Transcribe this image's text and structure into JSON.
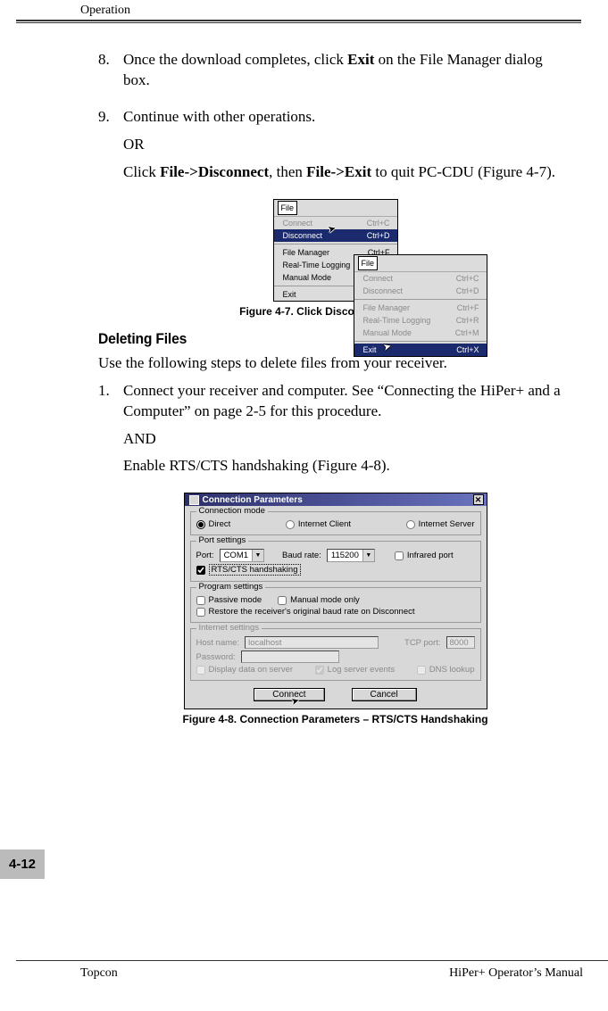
{
  "header": {
    "running_head": "Operation"
  },
  "body": {
    "step8_num": "8.",
    "step8_text_a": "Once the download completes, click ",
    "step8_bold": "Exit",
    "step8_text_b": " on the File Manager dialog box.",
    "step9_num": "9.",
    "step9_text": "Continue with other operations.",
    "or": "OR",
    "step9b_a": "Click ",
    "step9b_bold1": "File->Disconnect",
    "step9b_mid": ", then ",
    "step9b_bold2": "File->Exit",
    "step9b_end": " to quit PC-CDU (Figure 4-7).",
    "fig47_cap": "Figure 4-7. Click Disconnect then Exit",
    "section_heading": "Deleting Files",
    "intro": "Use the following steps to delete files from your receiver.",
    "step1_num": "1.",
    "step1_text": "Connect your receiver and computer. See “Connecting the HiPer+ and a Computer” on page 2-5 for this procedure.",
    "and": "AND",
    "step1b": "Enable RTS/CTS handshaking (Figure 4-8).",
    "fig48_cap": "Figure 4-8. Connection Parameters – RTS/CTS Handshaking"
  },
  "menu": {
    "file": "File",
    "connect": "Connect",
    "connect_k": "Ctrl+C",
    "disconnect": "Disconnect",
    "disconnect_k": "Ctrl+D",
    "file_manager": "File Manager",
    "file_manager_k": "Ctrl+F",
    "rt_logging": "Real-Time Logging",
    "rt_logging_k": "Ctrl+R",
    "manual": "Manual Mode",
    "manual_k": "Ctrl+M",
    "exit": "Exit",
    "exit_k": "Ctrl+X"
  },
  "dialog": {
    "title": "Connection Parameters",
    "conn_mode": "Connection mode",
    "direct": "Direct",
    "inet_client": "Internet Client",
    "inet_server": "Internet Server",
    "port_settings": "Port settings",
    "port_lbl": "Port:",
    "port_val": "COM1",
    "baud_lbl": "Baud rate:",
    "baud_val": "115200",
    "infrared": "Infrared port",
    "rts": "RTS/CTS handshaking",
    "prog_settings": "Program settings",
    "passive": "Passive mode",
    "manual_only": "Manual mode only",
    "restore": "Restore the receiver's original baud rate on Disconnect",
    "inet_settings": "Internet settings",
    "host_lbl": "Host name:",
    "host_val": "localhost",
    "tcp_lbl": "TCP port:",
    "tcp_val": "8000",
    "pass_lbl": "Password:",
    "display_srv": "Display data on server",
    "log_events": "Log server events",
    "dns_lookup": "DNS lookup",
    "connect_btn": "Connect",
    "cancel_btn": "Cancel"
  },
  "page_num": "4-12",
  "footer": {
    "left": "Topcon",
    "right": "HiPer+ Operator’s Manual"
  }
}
